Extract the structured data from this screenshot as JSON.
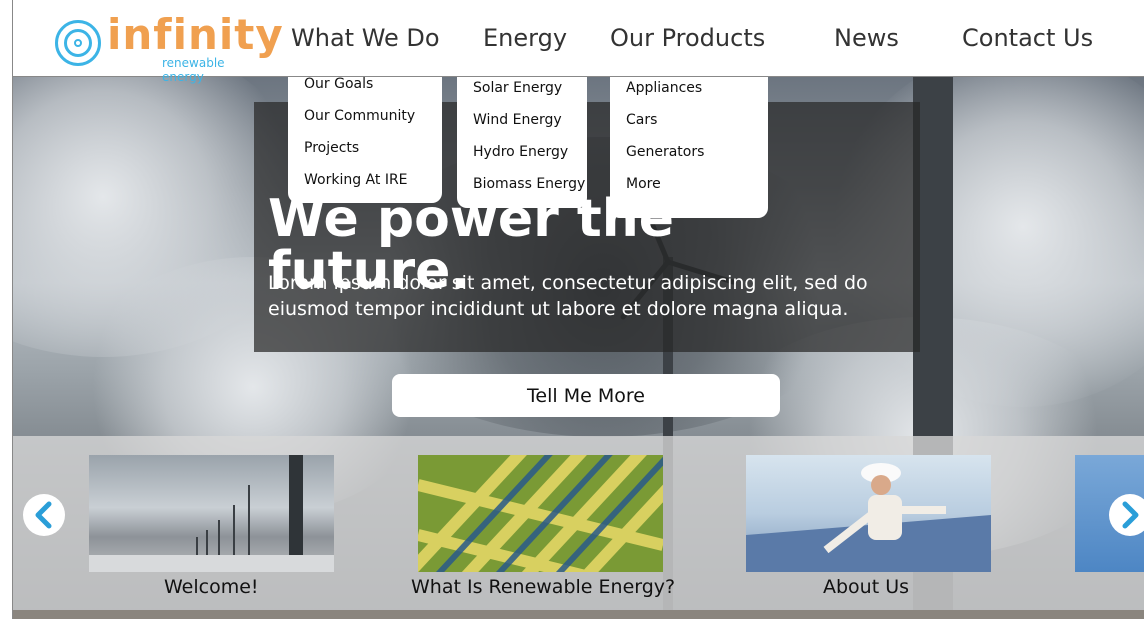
{
  "logo": {
    "word": "infinity",
    "tagline": "renewable energy"
  },
  "nav": {
    "items": [
      "What We Do",
      "Energy",
      "Our Products",
      "News",
      "Contact Us"
    ]
  },
  "dropdowns": {
    "what_we_do": [
      "Our Goals",
      "Our Community",
      "Projects",
      "Working At IRE"
    ],
    "energy": [
      "Solar Energy",
      "Wind Energy",
      "Hydro Energy",
      "Biomass Energy"
    ],
    "products": [
      "Appliances",
      "Cars",
      "Generators",
      "More"
    ]
  },
  "hero": {
    "headline_line1": "We power the",
    "headline_line2": "future.",
    "body": "Lorem ipsum dolor sit amet, consectetur adipiscing elit, sed do eiusmod tempor incididunt ut labore et dolore magna aliqua.",
    "cta": "Tell Me More"
  },
  "carousel": {
    "items": [
      "Welcome!",
      "What Is Renewable Energy?",
      "About Us"
    ]
  },
  "colors": {
    "brand_orange": "#f0a050",
    "brand_blue": "#3cb4e6"
  }
}
